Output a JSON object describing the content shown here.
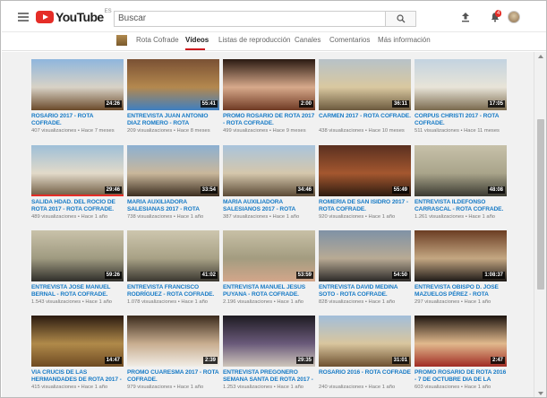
{
  "masthead": {
    "logo_text": "YouTube",
    "logo_region": "ES",
    "search_placeholder": "Buscar",
    "notification_count": "4"
  },
  "channel_tabs": [
    {
      "label": "Rota Cofrade",
      "active": false
    },
    {
      "label": "Vídeos",
      "active": true
    },
    {
      "label": "Listas de reproducción",
      "active": false
    },
    {
      "label": "Canales",
      "active": false
    },
    {
      "label": "Comentarios",
      "active": false
    },
    {
      "label": "Más información",
      "active": false
    }
  ],
  "videos": [
    {
      "title": "ROSARIO 2017 - ROTA COFRADE.",
      "views": "407 visualizaciones",
      "age": "Hace 7 meses",
      "duration": "24:26",
      "watched": 0.0,
      "colors": [
        "#8fb6dd",
        "#d8d2c6",
        "#6b4a2a"
      ]
    },
    {
      "title": "ENTREVISTA JUAN ANTONIO DIAZ ROMERO - ROTA COFRADE.",
      "views": "209 visualizaciones",
      "age": "Hace 8 meses",
      "duration": "55:41",
      "watched": 0.0,
      "colors": [
        "#7a5134",
        "#b4884e",
        "#3f7fc0"
      ]
    },
    {
      "title": "PROMO ROSARIO DE ROTA 2017 - ROTA COFRADE.",
      "views": "499 visualizaciones",
      "age": "Hace 9 meses",
      "duration": "2:00",
      "watched": 0.0,
      "colors": [
        "#2a1a12",
        "#d7a98b",
        "#6f3a24"
      ]
    },
    {
      "title": "CARMEN 2017 - ROTA COFRADE.",
      "views": "438 visualizaciones",
      "age": "Hace 10 meses",
      "duration": "36:11",
      "watched": 0.0,
      "colors": [
        "#b7c2c8",
        "#d9c8a0",
        "#6c5a3e"
      ]
    },
    {
      "title": "CORPUS CHRISTI 2017 - ROTA COFRADE.",
      "views": "511 visualizaciones",
      "age": "Hace 11 meses",
      "duration": "17:05",
      "watched": 0.0,
      "colors": [
        "#c3d3e0",
        "#e8e4d8",
        "#7a6a4e"
      ]
    },
    {
      "title": "SALIDA HDAD. DEL ROCÍO DE ROTA 2017 - ROTA COFRADE.",
      "views": "489 visualizaciones",
      "age": "Hace 1 año",
      "duration": "29:46",
      "watched": 1.0,
      "colors": [
        "#9ebfd8",
        "#e2dac9",
        "#6e5a40"
      ]
    },
    {
      "title": "MARÍA AUXILIADORA SALESIANAS 2017 - ROTA COFRADE.",
      "views": "738 visualizaciones",
      "age": "Hace 1 año",
      "duration": "33:54",
      "watched": 0.0,
      "colors": [
        "#8cb0d2",
        "#c9b79b",
        "#3c2e20"
      ]
    },
    {
      "title": "MARÍA AUXILIADORA SALESIANOS 2017 - ROTA COFRADE.",
      "views": "387 visualizaciones",
      "age": "Hace 1 año",
      "duration": "34:46",
      "watched": 0.0,
      "colors": [
        "#a9c4dc",
        "#d5c7ac",
        "#5b4a36"
      ]
    },
    {
      "title": "ROMERÍA DE SAN ISIDRO 2017 - ROTA COFRADE.",
      "views": "920 visualizaciones",
      "age": "Hace 1 año",
      "duration": "55:49",
      "watched": 0.0,
      "colors": [
        "#5a3020",
        "#a4572f",
        "#2e1b10"
      ]
    },
    {
      "title": "ENTREVISTA ILDEFONSO CARRASCAL - ROTA COFRADE.",
      "views": "1.261 visualizaciones",
      "age": "Hace 1 año",
      "duration": "48:08",
      "watched": 0.0,
      "colors": [
        "#c7c1aa",
        "#a9a48a",
        "#3b3a31"
      ]
    },
    {
      "title": "ENTREVISTA JOSÉ MANUEL BERNAL - ROTA COFRADE.",
      "views": "1.543 visualizaciones",
      "age": "Hace 1 año",
      "duration": "59:26",
      "watched": 0.0,
      "colors": [
        "#c9c2aa",
        "#9f9a80",
        "#2f2e2a"
      ]
    },
    {
      "title": "ENTREVISTA FRANCISCO RODRÍGUEZ - ROTA COFRADE.",
      "views": "1.078 visualizaciones",
      "age": "Hace 1 año",
      "duration": "41:02",
      "watched": 0.0,
      "colors": [
        "#cdc6ae",
        "#a8a185",
        "#3a3730"
      ]
    },
    {
      "title": "ENTREVISTA MANUEL JESÚS PUYANA - ROTA COFRADE.",
      "views": "2.196 visualizaciones",
      "age": "Hace 1 año",
      "duration": "53:59",
      "watched": 0.0,
      "colors": [
        "#c8c0a6",
        "#a39c80",
        "#d3a68a"
      ]
    },
    {
      "title": "ENTREVISTA DAVID MEDINA SOTO - ROTA COFRADE.",
      "views": "828 visualizaciones",
      "age": "Hace 1 año",
      "duration": "54:50",
      "watched": 0.0,
      "colors": [
        "#7f92a6",
        "#b8aa94",
        "#2c2a28"
      ]
    },
    {
      "title": "ENTREVISTA OBISPO D. JOSÉ MAZUELOS PÉREZ - ROTA COFRADE.",
      "views": "297 visualizaciones",
      "age": "Hace 1 año",
      "duration": "1:08:37",
      "watched": 0.0,
      "colors": [
        "#6b3d23",
        "#c4a782",
        "#1e1a18"
      ]
    },
    {
      "title": "VIA CRUCIS DE LAS HERMANDADES DE ROTA 2017 - ROTA COFRADE.",
      "views": "415 visualizaciones",
      "age": "Hace 1 año",
      "duration": "14:47",
      "watched": 0.0,
      "colors": [
        "#2a1a10",
        "#b08a4a",
        "#6e4a22"
      ]
    },
    {
      "title": "PROMO CUARESMA 2017 - ROTA COFRADE.",
      "views": "979 visualizaciones",
      "age": "Hace 1 año",
      "duration": "2:39",
      "watched": 0.0,
      "colors": [
        "#3a2a1c",
        "#c8ad8f",
        "#f1ede6"
      ]
    },
    {
      "title": "ENTREVISTA PREGONERO SEMANA SANTA DE ROTA 2017 - ROTA COFRADE.",
      "views": "1.253 visualizaciones",
      "age": "Hace 1 año",
      "duration": "29:35",
      "watched": 0.0,
      "colors": [
        "#1e1b22",
        "#6a5a7a",
        "#cfc6bc"
      ]
    },
    {
      "title": "ROSARIO 2016 - ROTA COFRADE",
      "views": "240 visualizaciones",
      "age": "Hace 1 año",
      "duration": "31:01",
      "watched": 0.0,
      "colors": [
        "#a2beda",
        "#d9c69e",
        "#6d5030"
      ]
    },
    {
      "title": "PROMO ROSARIO DE ROTA 2016 - 7 DE OCTUBRE DIA DE LA",
      "views": "603 visualizaciones",
      "age": "Hace 1 año",
      "duration": "2:47",
      "watched": 0.0,
      "colors": [
        "#1d140f",
        "#e1b98d",
        "#a02c24"
      ]
    }
  ]
}
